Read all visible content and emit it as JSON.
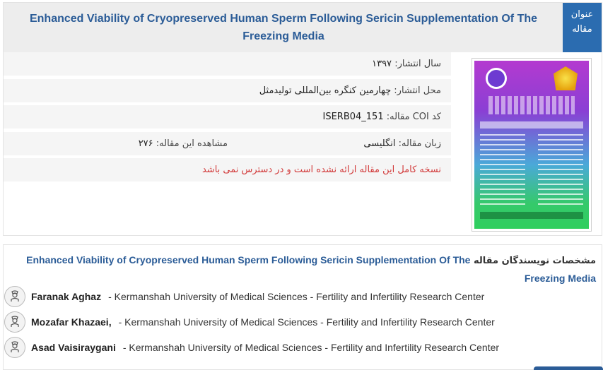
{
  "paper": {
    "label": "عنوان مقاله",
    "title": "Enhanced Viability of Cryopreserved Human Sperm Following Sericin Supplementation Of The Freezing Media"
  },
  "details": {
    "year_label": "سال انتشار:",
    "year_value": "۱۳۹۷",
    "venue_label": "محل انتشار:",
    "venue_value": "چهارمین کنگره بین‌المللی تولیدمثل",
    "coi_label": "کد COI مقاله:",
    "coi_value": "ISERB04_151",
    "language_label": "زبان مقاله:",
    "language_value": "انگلیسی",
    "views_label": "مشاهده این مقاله:",
    "views_value": "۲۷۶",
    "unavailable": "نسخه کامل این مقاله ارائه نشده است و در دسترس نمی باشد"
  },
  "authors_section": {
    "heading_prefix": "مشخصات نویسندگان مقاله",
    "heading_title": "Enhanced Viability of Cryopreserved Human Sperm Following Sericin Supplementation Of The Freezing Media",
    "authors": [
      {
        "name": "Faranak Aghaz",
        "affiliation": "- Kermanshah University of Medical Sciences - Fertility and Infertility Research Center"
      },
      {
        "name": "Mozafar Khazaei,",
        "affiliation": "- Kermanshah University of Medical Sciences - Fertility and Infertility Research Center"
      },
      {
        "name": "Asad Vaisiraygani",
        "affiliation": "- Kermanshah University of Medical Sciences - Fertility and Infertility Research Center"
      }
    ]
  },
  "icons": {
    "author": "person-icon"
  },
  "colors": {
    "accent": "#2b6cb0",
    "title": "#2b5c97",
    "warning": "#d23a3a"
  }
}
